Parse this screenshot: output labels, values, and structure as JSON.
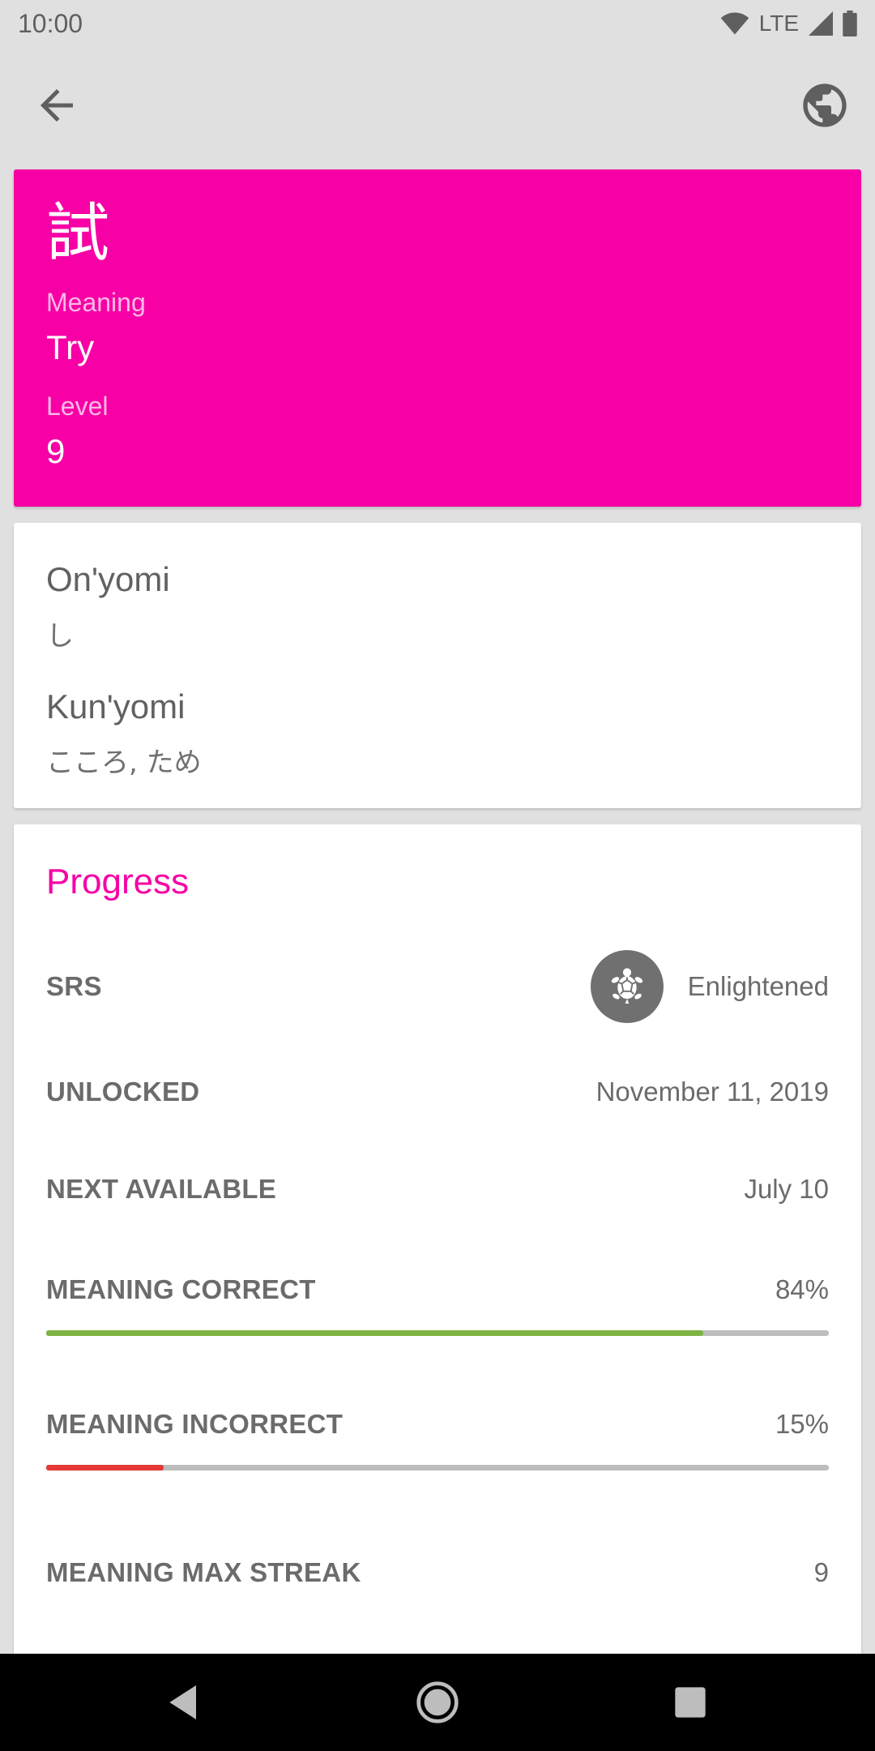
{
  "status": {
    "time": "10:00",
    "network": "LTE"
  },
  "toolbar": {
    "back_icon": "arrow-back-icon",
    "globe_icon": "globe-icon"
  },
  "kanji": {
    "character": "試",
    "meaning_label": "Meaning",
    "meaning": "Try",
    "level_label": "Level",
    "level": "9",
    "color": "#f700a5"
  },
  "readings": {
    "onyomi_label": "On'yomi",
    "onyomi": "し",
    "kunyomi_label": "Kun'yomi",
    "kunyomi": "こころ, ため"
  },
  "progress": {
    "heading": "Progress",
    "srs_label": "SRS",
    "srs_value": "Enlightened",
    "srs_icon": "turtle-icon",
    "unlocked_label": "UNLOCKED",
    "unlocked_value": "November 11, 2019",
    "next_label": "NEXT AVAILABLE",
    "next_value": "July 10",
    "meaning_correct_label": "MEANING CORRECT",
    "meaning_correct_value": "84%",
    "meaning_correct_fraction": 0.84,
    "meaning_correct_color": "#7cb342",
    "meaning_incorrect_label": "MEANING INCORRECT",
    "meaning_incorrect_value": "15%",
    "meaning_incorrect_fraction": 0.15,
    "meaning_incorrect_color": "#e53935",
    "max_streak_label": "MEANING MAX STREAK",
    "max_streak_value": "9"
  },
  "navbar": {
    "back": "nav-back-icon",
    "home": "nav-home-icon",
    "recents": "nav-recents-icon"
  }
}
